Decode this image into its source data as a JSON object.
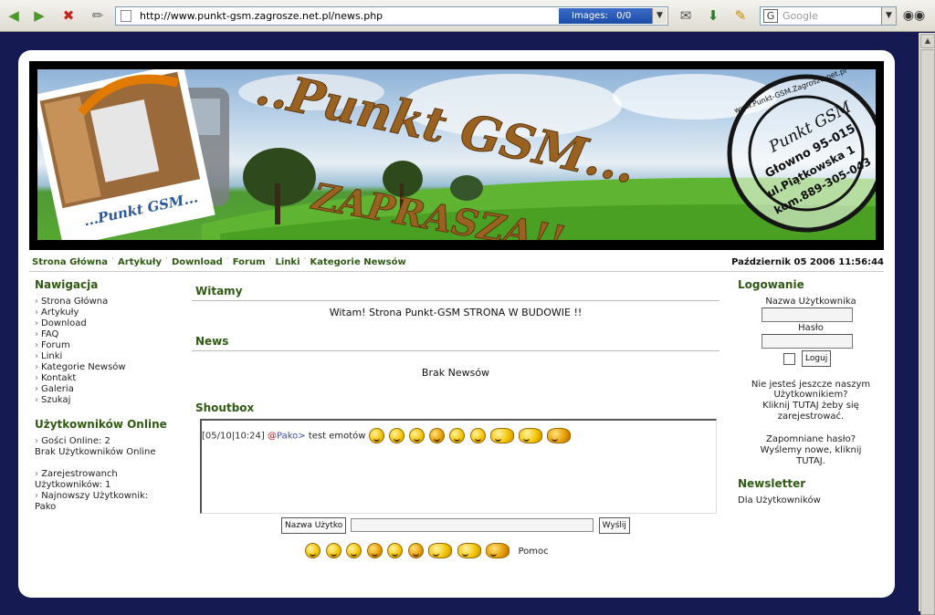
{
  "browser": {
    "url": "http://www.punkt-gsm.zagrosze.net.pl/news.php",
    "images_label": "Images:",
    "images_value": "0/0",
    "search_placeholder": "Google"
  },
  "banner": {
    "title_line1": "..Punkt GSM...",
    "title_line2": "ZAPRASZA!!",
    "photo_caption": "...Punkt GSM...",
    "stamp_name": "Punkt GSM",
    "stamp_addr1": "Głowno 95-015",
    "stamp_addr2": "ul.Piątkowska 1",
    "stamp_phone": "kom.889-305-043",
    "stamp_ring": "www.Punkt-GSM.Zagrosze.net.pl"
  },
  "nav": {
    "links": [
      "Strona Główna",
      "Artykuły",
      "Download",
      "Forum",
      "Linki",
      "Kategorie Newsów"
    ],
    "date": "Październik 05 2006 11:56:44"
  },
  "left": {
    "nav_heading": "Nawigacja",
    "nav_items": [
      "Strona Główna",
      "Artykuły",
      "Download",
      "FAQ",
      "Forum",
      "Linki",
      "Kategorie Newsów",
      "Kontakt",
      "Galeria",
      "Szukaj"
    ],
    "online_heading": "Użytkowników Online",
    "guests": "Gości Online: 2",
    "no_users": "Brak Użytkowników Online",
    "registered_1": "Zarejestrowanch",
    "registered_2": "Użytkowników: 1",
    "newest_1": "Najnowszy Użytkownik:",
    "newest_2": "Pako"
  },
  "main": {
    "welcome_heading": "Witamy",
    "welcome_text": "Witam! Strona Punkt-GSM STRONA W BUDOWIE !!",
    "news_heading": "News",
    "news_text": "Brak Newsów",
    "shoutbox_heading": "Shoutbox",
    "shout_time": "[05/10|10:24]",
    "shout_at": "@",
    "shout_user": "Pako",
    "shout_arrow": ">",
    "shout_msg": "test emotów",
    "name_button": "Nazwa Użytko",
    "send_button": "Wyślij",
    "help_link": "Pomoc"
  },
  "right": {
    "login_heading": "Logowanie",
    "username_label": "Nazwa Użytkownika",
    "password_label": "Hasło",
    "login_button": "Loguj",
    "register_1": "Nie jesteś jeszcze naszym",
    "register_2": "Użytkownikiem?",
    "register_3": "Kliknij TUTAJ żeby się",
    "register_4": "zarejestrować.",
    "forgot_1": "Zapomniane hasło?",
    "forgot_2": "Wyślemy nowe, kliknij",
    "forgot_3": "TUTAJ.",
    "newsletter_heading": "Newsletter",
    "newsletter_text": "Dla Użytkowników"
  }
}
